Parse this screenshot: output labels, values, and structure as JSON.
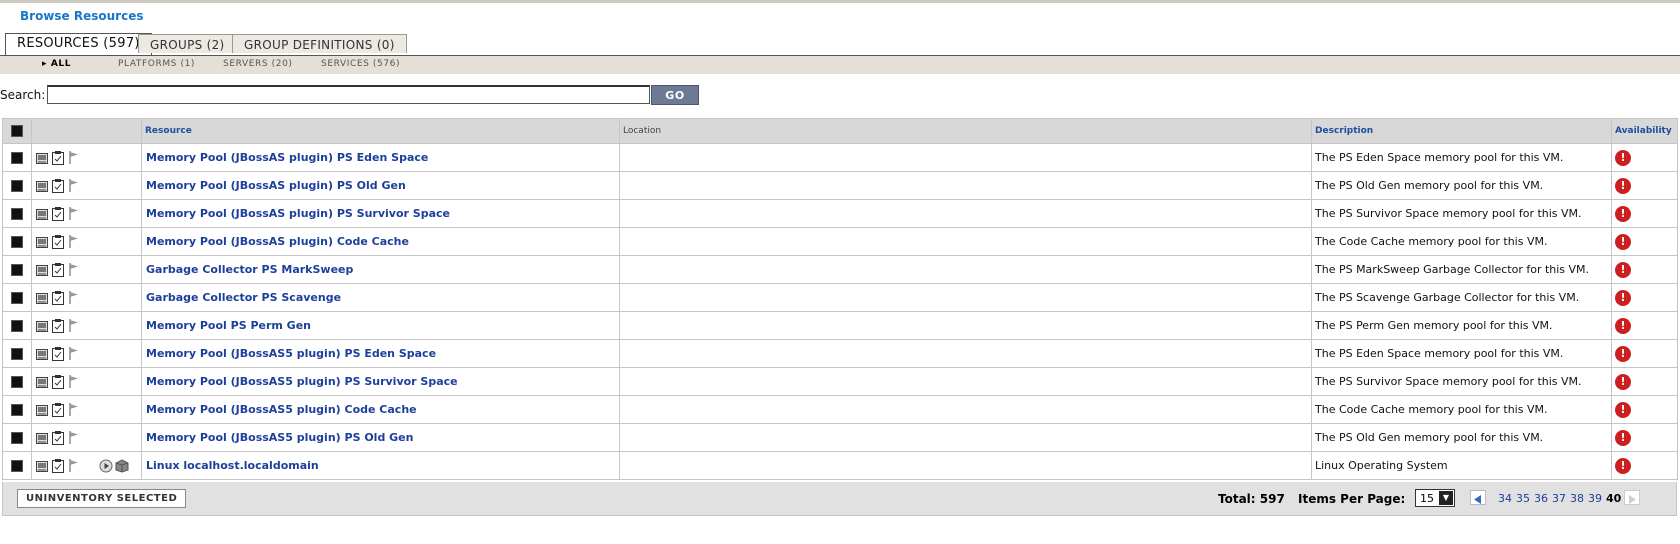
{
  "breadcrumb": "Browse Resources",
  "tabs": [
    {
      "label": "RESOURCES (597)"
    },
    {
      "label": "GROUPS (2)"
    },
    {
      "label": "GROUP DEFINITIONS (0)"
    }
  ],
  "subnav": [
    {
      "label": "ALL"
    },
    {
      "label": "PLATFORMS (1)"
    },
    {
      "label": "SERVERS (20)"
    },
    {
      "label": "SERVICES (576)"
    }
  ],
  "search": {
    "label": "Search:",
    "value": "",
    "go_label": "GO"
  },
  "table": {
    "columns": [
      "Resource",
      "Location",
      "Description",
      "Availability"
    ],
    "rows": [
      {
        "name": "Memory Pool (JBossAS plugin) PS Eden Space",
        "location": "",
        "description": "The PS Eden Space memory pool for this VM.",
        "availability": "down"
      },
      {
        "name": "Memory Pool (JBossAS plugin) PS Old Gen",
        "location": "",
        "description": "The PS Old Gen memory pool for this VM.",
        "availability": "down"
      },
      {
        "name": "Memory Pool (JBossAS plugin) PS Survivor Space",
        "location": "",
        "description": "The PS Survivor Space memory pool for this VM.",
        "availability": "down"
      },
      {
        "name": "Memory Pool (JBossAS plugin) Code Cache",
        "location": "",
        "description": "The Code Cache memory pool for this VM.",
        "availability": "down"
      },
      {
        "name": "Garbage Collector PS MarkSweep",
        "location": "",
        "description": "The PS MarkSweep Garbage Collector for this VM.",
        "availability": "down"
      },
      {
        "name": "Garbage Collector PS Scavenge",
        "location": "",
        "description": "The PS Scavenge Garbage Collector for this VM.",
        "availability": "down"
      },
      {
        "name": "Memory Pool PS Perm Gen",
        "location": "",
        "description": "The PS Perm Gen memory pool for this VM.",
        "availability": "down"
      },
      {
        "name": "Memory Pool (JBossAS5 plugin) PS Eden Space",
        "location": "",
        "description": "The PS Eden Space memory pool for this VM.",
        "availability": "down"
      },
      {
        "name": "Memory Pool (JBossAS5 plugin) PS Survivor Space",
        "location": "",
        "description": "The PS Survivor Space memory pool for this VM.",
        "availability": "down"
      },
      {
        "name": "Memory Pool (JBossAS5 plugin) Code Cache",
        "location": "",
        "description": "The Code Cache memory pool for this VM.",
        "availability": "down"
      },
      {
        "name": "Memory Pool (JBossAS5 plugin) PS Old Gen",
        "location": "",
        "description": "The PS Old Gen memory pool for this VM.",
        "availability": "down"
      },
      {
        "name": "Linux localhost.localdomain",
        "location": "",
        "description": "Linux Operating System",
        "availability": "down",
        "extra_icons": [
          "play-icon",
          "package-icon"
        ]
      }
    ]
  },
  "footer": {
    "uninventory_label": "UNINVENTORY SELECTED",
    "total_label": "Total: 597",
    "items_per_page_label": "Items Per Page:",
    "items_per_page": "15",
    "pages": [
      "34",
      "35",
      "36",
      "37",
      "38",
      "39",
      "40"
    ],
    "current_page": "40"
  },
  "colors": {
    "link": "#1c3f9c",
    "accent": "#1a75c8",
    "error": "#cc1f1f",
    "go_button": "#6c7a93"
  }
}
